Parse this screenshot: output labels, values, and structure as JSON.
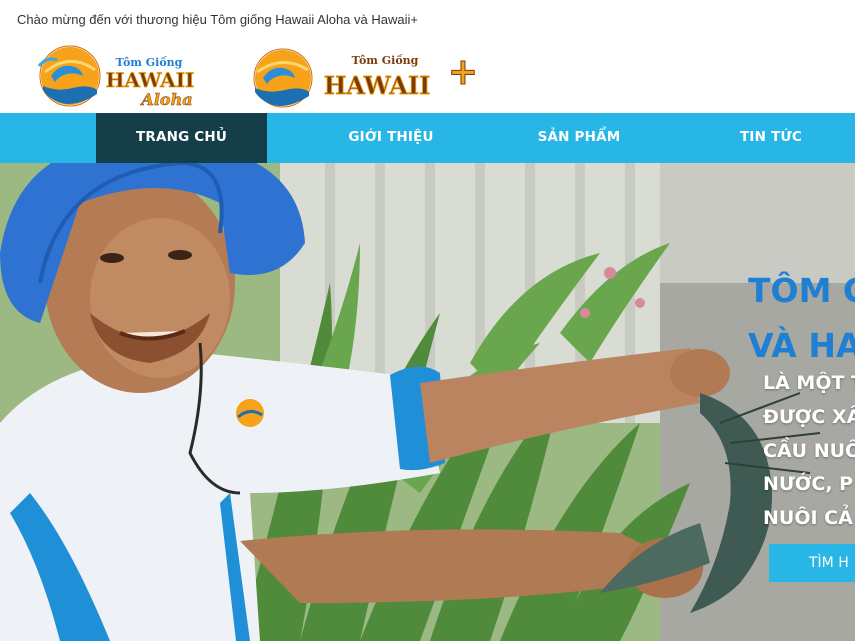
{
  "topbar": {
    "welcome": "Chào mừng đến với thương hiệu Tôm giống Hawaii Aloha và Hawaii+"
  },
  "logos": {
    "aloha": {
      "top": "Tôm Giống",
      "main": "HAWAII",
      "sub": "Aloha"
    },
    "plus": {
      "top": "Tôm Giống",
      "main": "HAWAII",
      "sign": "+"
    }
  },
  "nav": {
    "items": [
      {
        "label": "TRANG CHỦ",
        "active": true
      },
      {
        "label": "GIỚI THIỆU",
        "active": false
      },
      {
        "label": "SẢN PHẨM",
        "active": false
      },
      {
        "label": "TIN TỨC",
        "active": false
      }
    ]
  },
  "hero": {
    "title_line1": "TÔM G",
    "title_line2": "VÀ HAV",
    "lines": [
      "LÀ MỘT T",
      "ĐƯỢC XÂ",
      "CẦU NUÔ",
      "NƯỚC, P",
      "NUÔI CẢ"
    ],
    "button": "TÌM H"
  },
  "colors": {
    "nav_bg": "#27b6e6",
    "nav_active_bg": "#143e48",
    "hero_title": "#1f7fd3",
    "logo_gold": "#f2a21b",
    "logo_brown": "#7a3b0c"
  }
}
